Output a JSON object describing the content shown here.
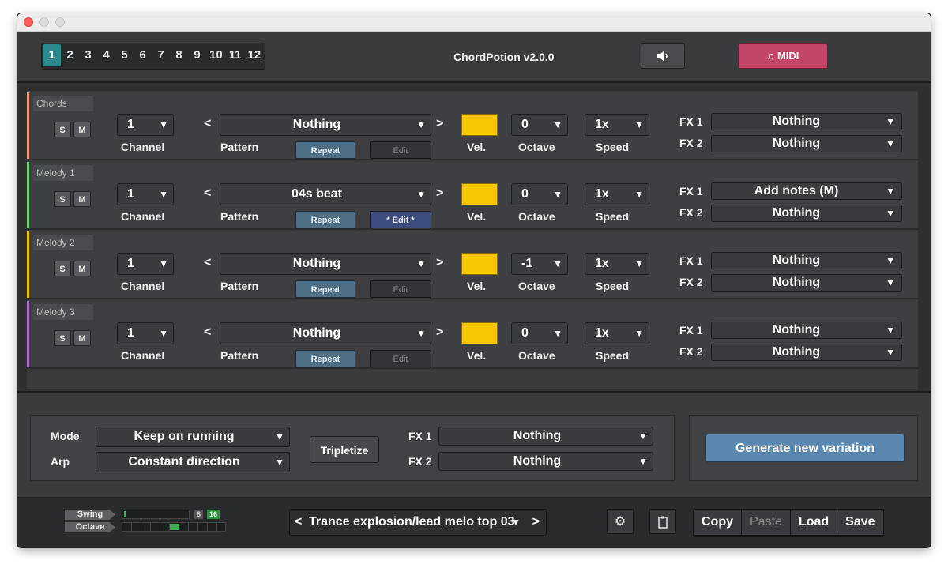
{
  "window": {
    "title": "ChordPotion v2.0.0",
    "tabs": [
      "1",
      "2",
      "3",
      "4",
      "5",
      "6",
      "7",
      "8",
      "9",
      "10",
      "11",
      "12"
    ],
    "active_tab": "1",
    "volume_icon": "speaker-icon",
    "midi_label": "MIDI",
    "midi_icon": "music-note-icon",
    "midi_color": "#c24767",
    "active_tab_color": "#2c8a8e"
  },
  "labels": {
    "channel": "Channel",
    "pattern": "Pattern",
    "repeat": "Repeat",
    "edit": "Edit",
    "vel": "Vel.",
    "octave": "Octave",
    "speed": "Speed",
    "fx1": "FX 1",
    "fx2": "FX 2",
    "s": "S",
    "m": "M"
  },
  "tracks": [
    {
      "name": "Chords",
      "color": "#f0a070",
      "channel": "1",
      "pattern": "Nothing",
      "edit_label": "Edit",
      "edit_active": false,
      "octave": "0",
      "speed": "1x",
      "fx1": "Nothing",
      "fx2": "Nothing"
    },
    {
      "name": "Melody 1",
      "color": "#6fd36f",
      "channel": "1",
      "pattern": "04s beat",
      "edit_label": "* Edit *",
      "edit_active": true,
      "octave": "0",
      "speed": "1x",
      "fx1": "Add notes (M)",
      "fx2": "Nothing"
    },
    {
      "name": "Melody 2",
      "color": "#f5c400",
      "channel": "1",
      "pattern": "Nothing",
      "edit_label": "Edit",
      "edit_active": false,
      "octave": "-1",
      "speed": "1x",
      "fx1": "Nothing",
      "fx2": "Nothing"
    },
    {
      "name": "Melody 3",
      "color": "#b070d0",
      "channel": "1",
      "pattern": "Nothing",
      "edit_label": "Edit",
      "edit_active": false,
      "octave": "0",
      "speed": "1x",
      "fx1": "Nothing",
      "fx2": "Nothing"
    }
  ],
  "vel_color": "#f7c700",
  "arp": {
    "mode_label": "Mode",
    "mode_value": "Keep on running",
    "arp_label": "Arp",
    "arp_value": "Constant direction",
    "tripletize_label": "Tripletize",
    "fx1_label": "FX 1",
    "fx1_value": "Nothing",
    "fx2_label": "FX 2",
    "fx2_value": "Nothing",
    "generate_label": "Generate new variation"
  },
  "footer": {
    "swing_label": "Swing",
    "octave_label": "Octave",
    "swing_badges": [
      "8",
      "16"
    ],
    "preset": "Trance explosion/lead melo top 03",
    "settings_icon": "gear-icon",
    "clipboard_icon": "clipboard-icon",
    "copy": "Copy",
    "paste": "Paste",
    "load": "Load",
    "save": "Save"
  }
}
